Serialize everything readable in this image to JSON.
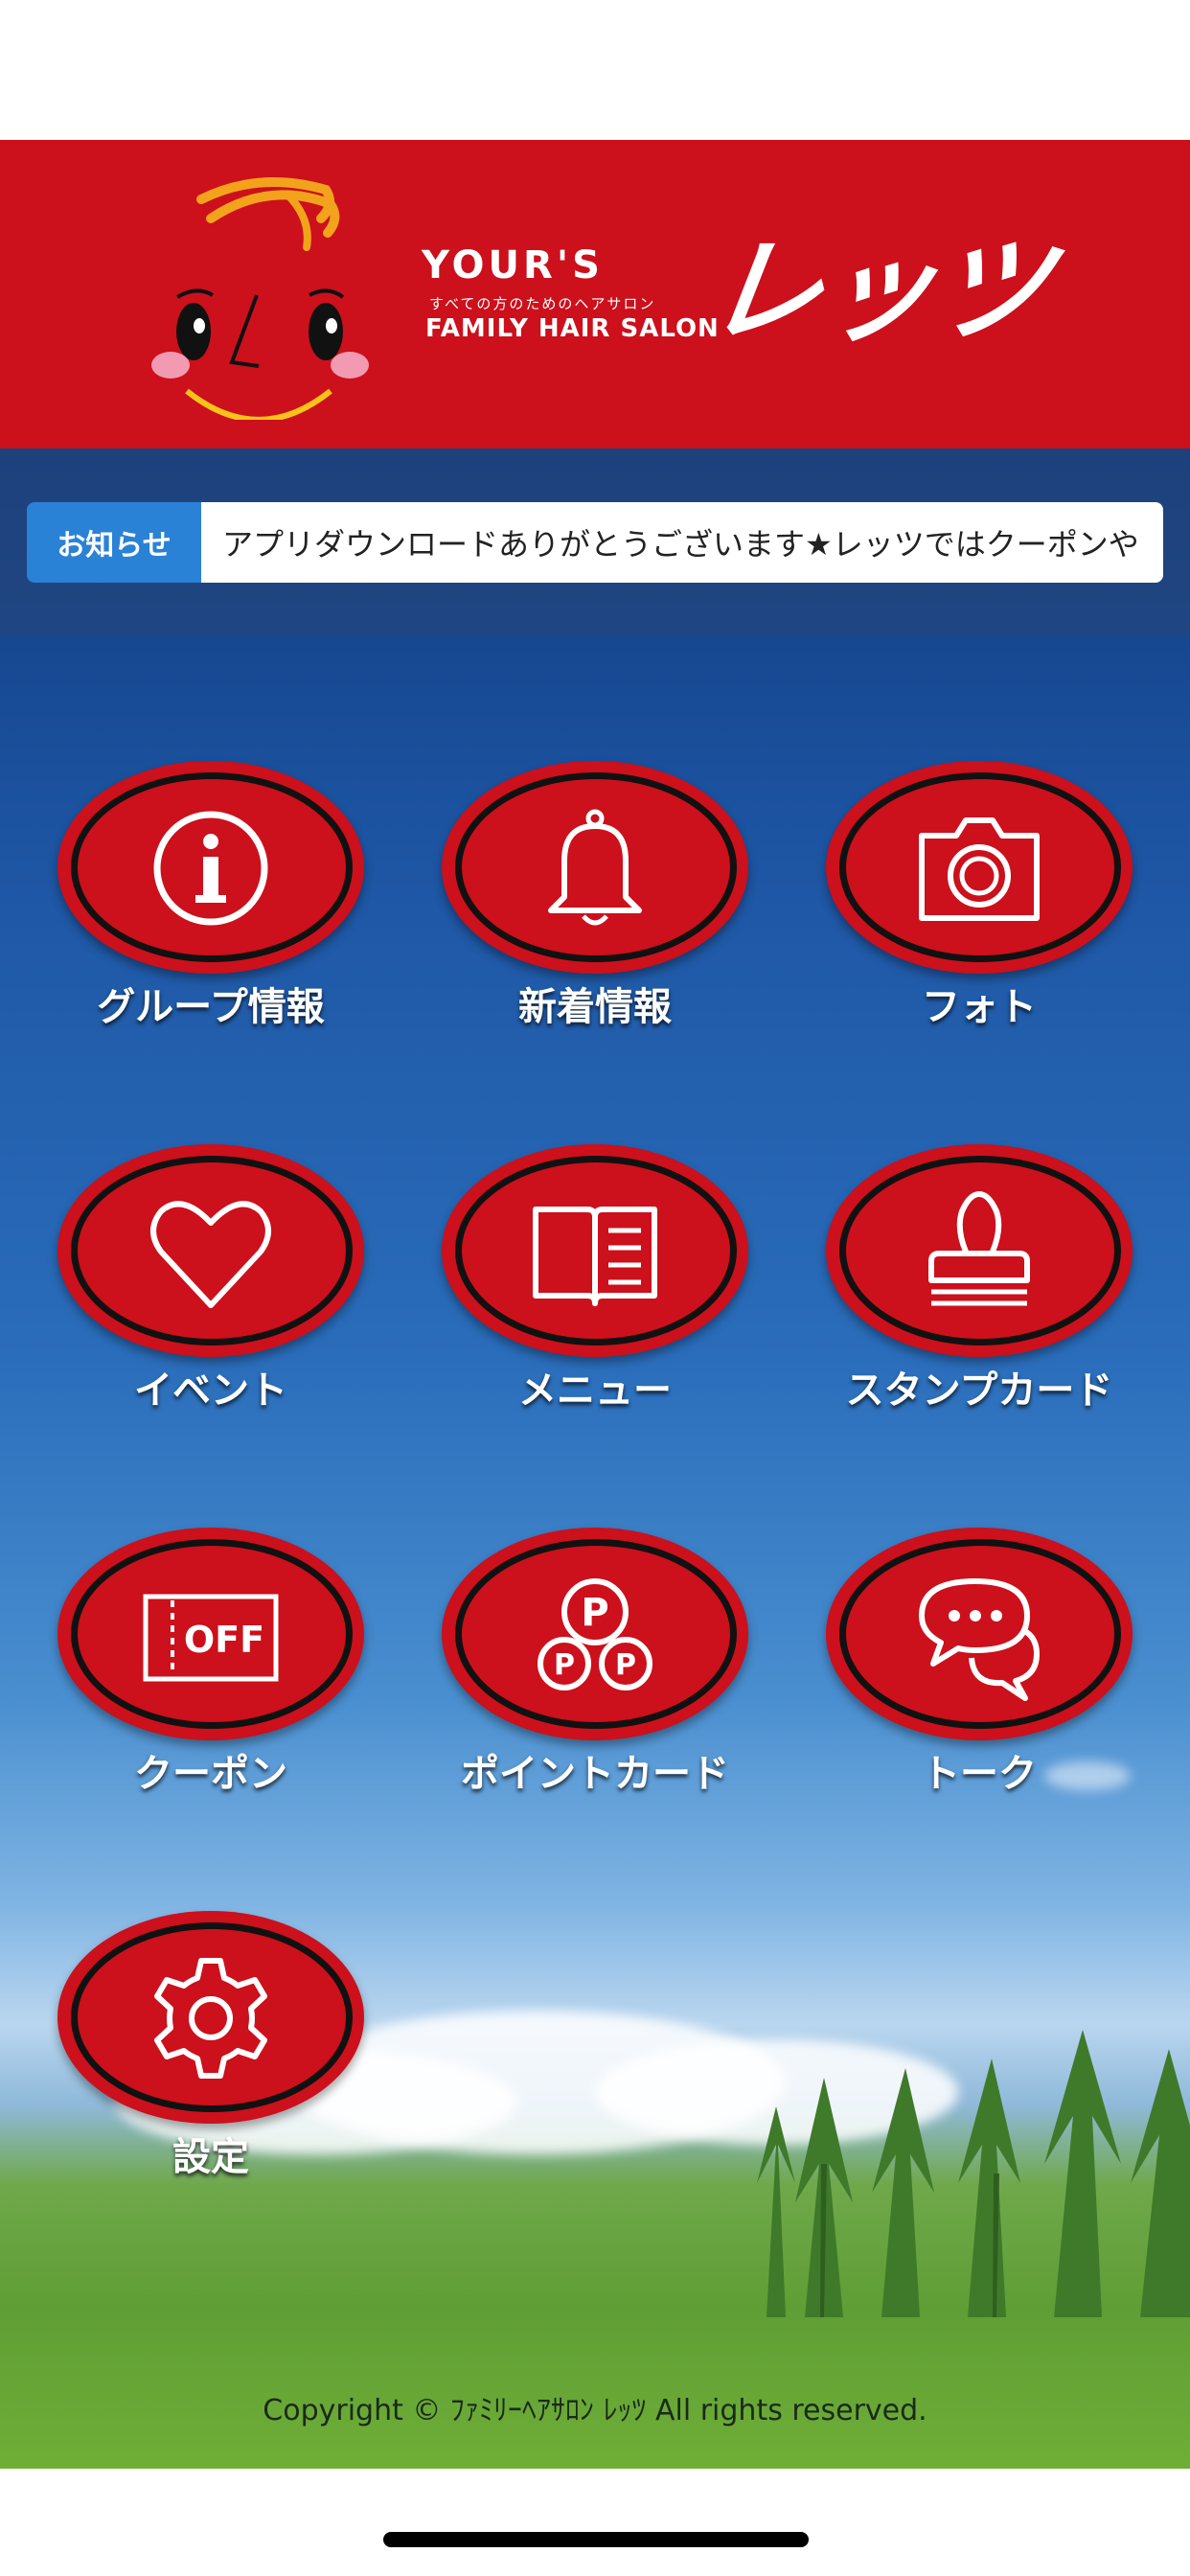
{
  "header": {
    "brand_top": "YOUR'S",
    "brand_sub": "すべての方のためのヘアサロン",
    "brand_bottom": "FAMILY HAIR SALON",
    "brand_kana": "レッツ",
    "background_color": "#cc101c"
  },
  "news": {
    "label": "お知らせ",
    "ticker_text": "アプリダウンロードありがとうございます★レッツではクーポンや"
  },
  "menu": [
    {
      "label": "グループ情報",
      "icon": "info-icon"
    },
    {
      "label": "新着情報",
      "icon": "bell-icon"
    },
    {
      "label": "フォト",
      "icon": "camera-icon"
    },
    {
      "label": "イベント",
      "icon": "heart-icon"
    },
    {
      "label": "メニュー",
      "icon": "book-icon"
    },
    {
      "label": "スタンプカード",
      "icon": "stamp-icon"
    },
    {
      "label": "クーポン",
      "icon": "coupon-icon",
      "icon_text": "OFF"
    },
    {
      "label": "ポイントカード",
      "icon": "points-icon",
      "icon_text": "P"
    },
    {
      "label": "トーク",
      "icon": "chat-icon"
    },
    {
      "label": "設定",
      "icon": "gear-icon"
    }
  ],
  "footer": {
    "copyright": "Copyright © ﾌｧﾐﾘｰﾍｱｻﾛﾝ ﾚｯﾂ All rights reserved."
  },
  "colors": {
    "accent_red": "#cc101c",
    "news_label_blue": "#2a82d6"
  }
}
